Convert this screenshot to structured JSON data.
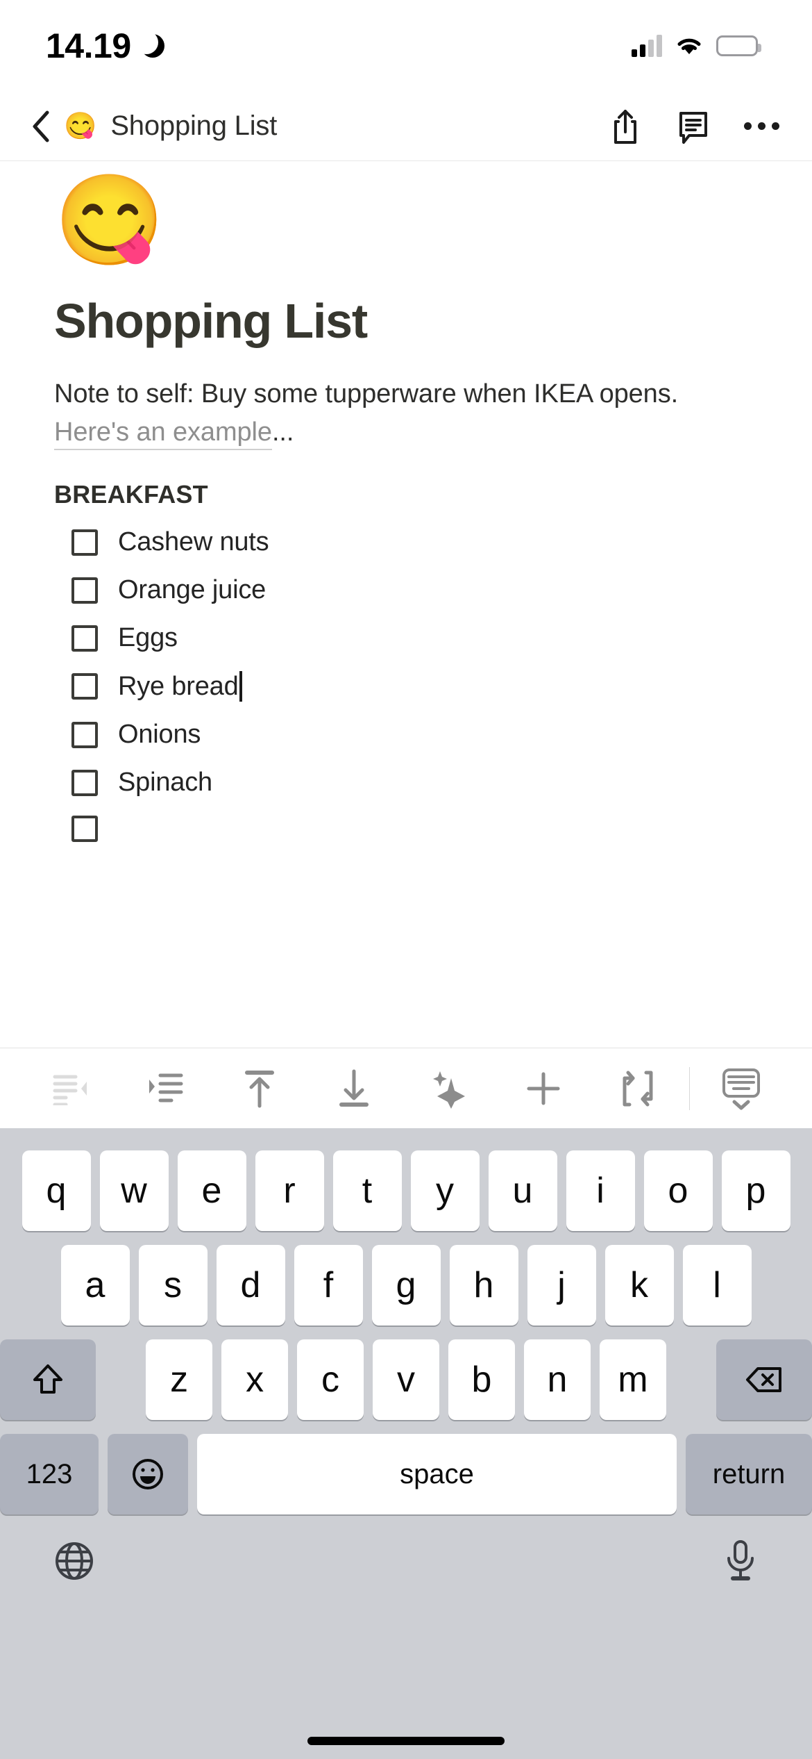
{
  "status_bar": {
    "time": "14.19",
    "dnd_icon": "crescent-moon-icon",
    "signal_icon": "cellular-signal-icon",
    "wifi_icon": "wifi-icon",
    "battery_icon": "battery-icon"
  },
  "nav_bar": {
    "back_icon": "chevron-left-icon",
    "emoji": "😋",
    "title": "Shopping List",
    "share_icon": "share-icon",
    "comment_icon": "comment-icon",
    "more_icon": "more-ellipsis-icon"
  },
  "note": {
    "emoji": "😋",
    "title": "Shopping List",
    "paragraph_before": "Note to self: Buy some tupperware when IKEA opens. ",
    "link_text": "Here's an example",
    "paragraph_after": "...",
    "section_heading": "BREAKFAST",
    "items": [
      {
        "label": "Cashew nuts",
        "checked": false
      },
      {
        "label": "Orange juice",
        "checked": false
      },
      {
        "label": "Eggs",
        "checked": false
      },
      {
        "label": "Rye bread",
        "checked": false,
        "cursor": true
      },
      {
        "label": "Onions",
        "checked": false
      },
      {
        "label": "Spinach",
        "checked": false
      },
      {
        "label": "",
        "checked": false
      }
    ]
  },
  "format_toolbar": {
    "buttons": [
      {
        "name": "outdent-icon",
        "label": "Outdent",
        "disabled": true
      },
      {
        "name": "indent-icon",
        "label": "Indent",
        "disabled": false
      },
      {
        "name": "move-up-icon",
        "label": "Move up",
        "disabled": false
      },
      {
        "name": "move-down-icon",
        "label": "Move down",
        "disabled": false
      },
      {
        "name": "ai-sparkle-icon",
        "label": "AI assist",
        "disabled": false
      },
      {
        "name": "plus-icon",
        "label": "Insert",
        "disabled": false
      },
      {
        "name": "convert-swap-icon",
        "label": "Turn into",
        "disabled": false
      },
      {
        "name": "hide-keyboard-icon",
        "label": "Hide keyboard",
        "disabled": false
      }
    ]
  },
  "keyboard": {
    "row1": [
      "q",
      "w",
      "e",
      "r",
      "t",
      "y",
      "u",
      "i",
      "o",
      "p"
    ],
    "row2": [
      "a",
      "s",
      "d",
      "f",
      "g",
      "h",
      "j",
      "k",
      "l"
    ],
    "row3": [
      "z",
      "x",
      "c",
      "v",
      "b",
      "n",
      "m"
    ],
    "shift_icon": "shift-arrow-icon",
    "backspace_icon": "backspace-icon",
    "numbers_key": "123",
    "emoji_key_icon": "emoji-smiley-icon",
    "space_key": "space",
    "return_key": "return",
    "globe_icon": "globe-icon",
    "mic_icon": "microphone-icon"
  },
  "colors": {
    "keyboard_bg": "#cdcfd4",
    "key_white": "#ffffff",
    "key_dark": "#aeb2bd",
    "text_dark": "#2e2e2c",
    "link_gray": "#8e8e8e",
    "toolbar_icon": "#8c8c8c"
  }
}
